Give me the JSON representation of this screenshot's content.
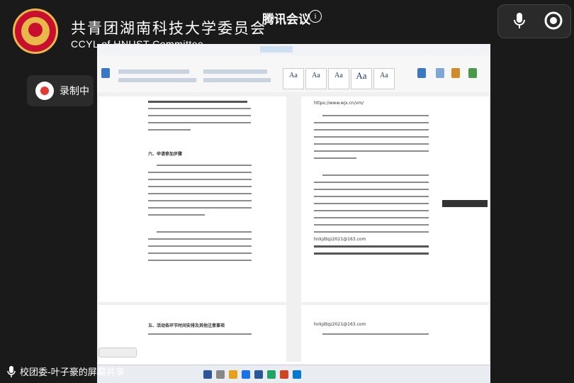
{
  "app": {
    "meeting_title": "腾讯会议",
    "info_icon": "info-icon",
    "recording_label": "录制中",
    "sharer_label": "校团委-叶子豪的屏幕共享"
  },
  "organization": {
    "name_cn": "共青团湖南科技大学委员会",
    "name_en": "CCYL of HNUST Committee"
  },
  "controls": {
    "mic_icon": "microphone-icon",
    "share_icon": "screen-share-icon"
  },
  "colors": {
    "background": "#1a1a1a",
    "recording_red": "#e53935",
    "logo_red": "#c8102e",
    "logo_gold": "#e8b84a",
    "word_blue": "#2b579a"
  },
  "shared_doc": {
    "left_page_heading": "六、申请参加步骤",
    "right_page_url": "https://www.wjx.cn/vm/",
    "right_page_email": "hnkjdtqz2021@163.com",
    "bottom_left_heading": "五、活动各环节时间安排及其他注意事项",
    "bottom_right_line": "hnkjdtqz2021@163.com"
  }
}
